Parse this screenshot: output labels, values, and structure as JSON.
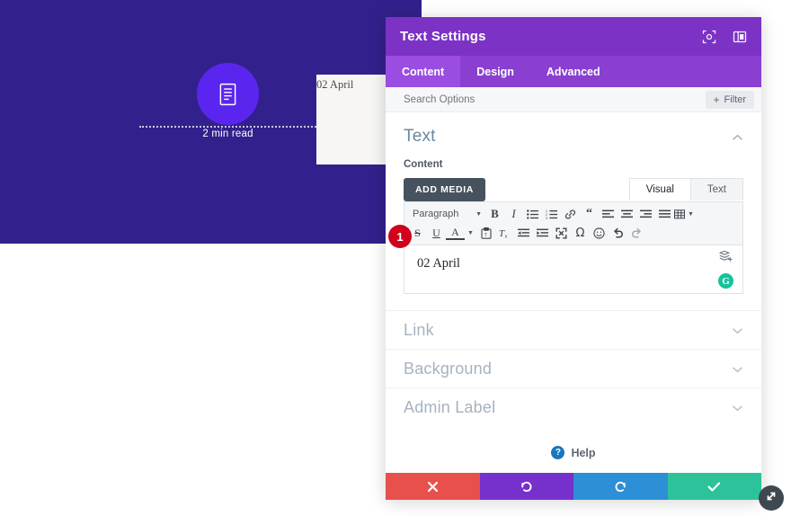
{
  "preview": {
    "read_time": "2 min read",
    "card_text": "02 April",
    "doc_icon": "document-icon",
    "bg_color": "#32218c",
    "circle_color": "#5b25f0"
  },
  "modal": {
    "title": "Text Settings",
    "header_icons": [
      {
        "name": "focus-target-icon"
      },
      {
        "name": "panel-layout-icon"
      }
    ],
    "tabs": [
      {
        "label": "Content",
        "active": true
      },
      {
        "label": "Design",
        "active": false
      },
      {
        "label": "Advanced",
        "active": false
      }
    ],
    "search": {
      "placeholder": "Search Options",
      "value": ""
    },
    "filter_button": {
      "label": "Filter",
      "plus": "+"
    },
    "text_section": {
      "title": "Text",
      "chevron": "collapse-chevron-up",
      "field_label": "Content",
      "add_media_label": "ADD MEDIA",
      "mode_tabs": [
        {
          "label": "Visual",
          "active": true
        },
        {
          "label": "Text",
          "active": false
        }
      ],
      "toolbar_row1": [
        {
          "name": "paragraph-format-select",
          "label": "Paragraph"
        },
        {
          "name": "bold-icon",
          "glyph": "B"
        },
        {
          "name": "italic-icon",
          "glyph": "I"
        },
        {
          "name": "bullet-list-icon"
        },
        {
          "name": "numbered-list-icon"
        },
        {
          "name": "link-icon"
        },
        {
          "name": "blockquote-icon",
          "glyph": "“"
        },
        {
          "name": "align-left-icon"
        },
        {
          "name": "align-center-icon"
        },
        {
          "name": "align-right-icon"
        },
        {
          "name": "align-justify-icon"
        },
        {
          "name": "table-icon"
        }
      ],
      "toolbar_row2": [
        {
          "name": "strikethrough-icon",
          "glyph": "S"
        },
        {
          "name": "underline-icon",
          "glyph": "U"
        },
        {
          "name": "text-color-icon",
          "glyph": "A"
        },
        {
          "name": "paste-as-text-icon"
        },
        {
          "name": "clear-formatting-icon"
        },
        {
          "name": "outdent-icon"
        },
        {
          "name": "indent-icon"
        },
        {
          "name": "fullscreen-icon"
        },
        {
          "name": "special-character-icon",
          "glyph": "Ω"
        },
        {
          "name": "emoji-icon"
        },
        {
          "name": "undo-icon"
        },
        {
          "name": "redo-icon"
        }
      ],
      "editor_value": "02 April",
      "step_badge": "1",
      "side_icons": [
        {
          "name": "add-layer-icon"
        },
        {
          "name": "grammarly-icon",
          "glyph": "G"
        }
      ]
    },
    "accordion": [
      {
        "label": "Link",
        "chevron": "expand-chevron-down"
      },
      {
        "label": "Background",
        "chevron": "expand-chevron-down"
      },
      {
        "label": "Admin Label",
        "chevron": "expand-chevron-down"
      }
    ],
    "help": {
      "label": "Help",
      "icon_glyph": "?"
    },
    "action_buttons": [
      {
        "name": "cancel-button",
        "icon": "close-x-icon",
        "color": "#e8504c"
      },
      {
        "name": "undo-button",
        "icon": "undo-arrow-icon",
        "color": "#7631cd"
      },
      {
        "name": "redo-button",
        "icon": "redo-arrow-icon",
        "color": "#2d8fd5"
      },
      {
        "name": "save-button",
        "icon": "checkmark-icon",
        "color": "#2cc39b"
      }
    ],
    "resize_handle": "resize-diagonal-icon"
  }
}
